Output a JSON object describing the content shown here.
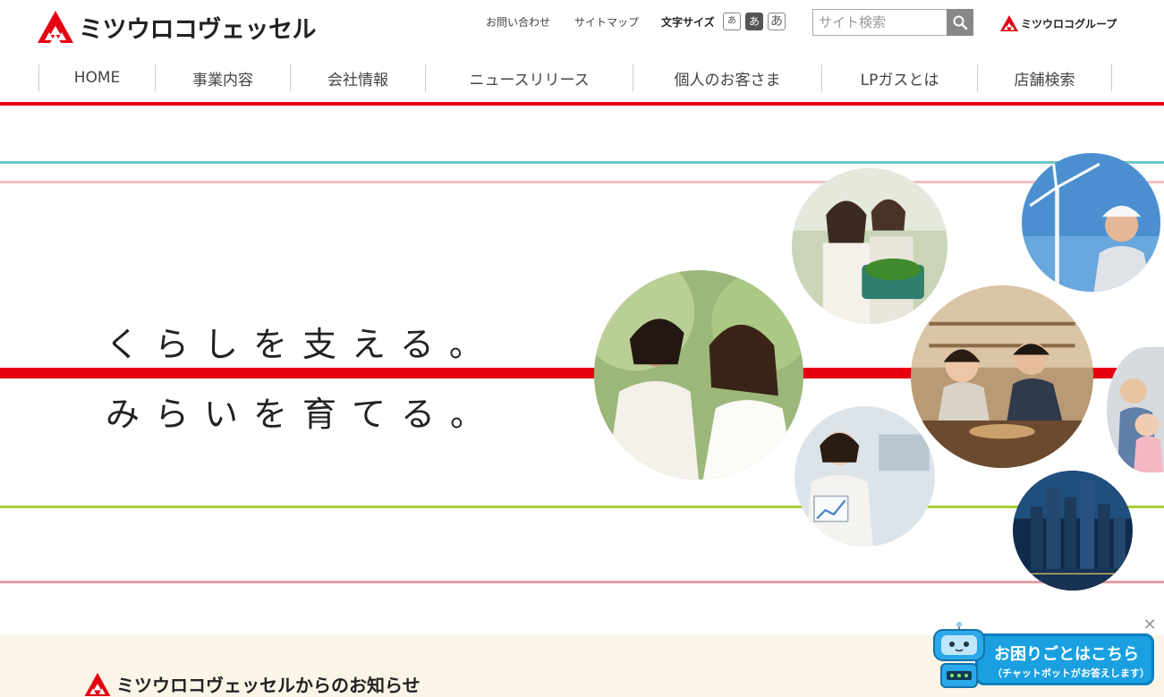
{
  "brand": {
    "name": "ミツウロコヴェッセル",
    "group_name": "ミツウロコグループ",
    "red": "#e50012"
  },
  "utility": {
    "contact": "お問い合わせ",
    "sitemap": "サイトマップ",
    "font_size_label": "文字サイズ",
    "font_size_small": "あ",
    "font_size_medium": "あ",
    "font_size_large": "あ"
  },
  "search": {
    "placeholder": "サイト検索",
    "icon": "search-icon"
  },
  "nav": {
    "items": [
      {
        "label": "HOME"
      },
      {
        "label": "事業内容"
      },
      {
        "label": "会社情報"
      },
      {
        "label": "ニュースリリース"
      },
      {
        "label": "個人のお客さま"
      },
      {
        "label": "LPガスとは"
      },
      {
        "label": "店舗検索"
      }
    ]
  },
  "hero": {
    "line1": "くらしを支える。",
    "line2": "みらいを育てる。",
    "stripe_colors": {
      "teal": "#6cc9c6",
      "pink": "#f1bfc7",
      "red": "#e50012",
      "green": "#a7cf3a",
      "rose": "#e7a0a8"
    }
  },
  "notice": {
    "title": "ミツウロコヴェッセルからのお知らせ"
  },
  "chatbot": {
    "main": "お困りごとはこちら",
    "sub": "（チャットボットがお答えします）",
    "close_icon": "close-icon"
  }
}
